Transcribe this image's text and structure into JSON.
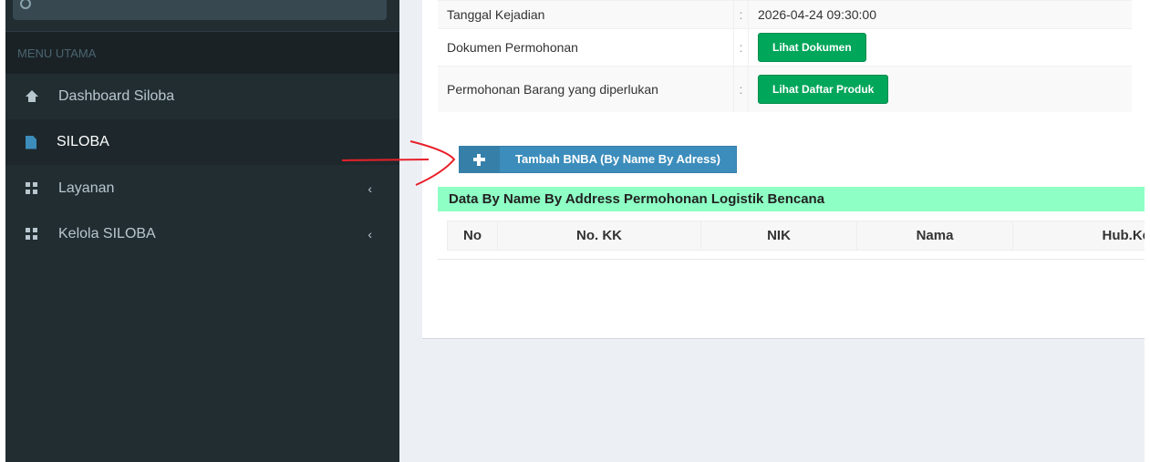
{
  "sidebar": {
    "menu_header": "MENU UTAMA",
    "items": [
      {
        "label": "Dashboard Siloba",
        "icon": "home-icon"
      },
      {
        "label": "SILOBA",
        "icon": "file-icon"
      },
      {
        "label": "Layanan",
        "icon": "grid-icon"
      },
      {
        "label": "Kelola SILOBA",
        "icon": "grid-icon"
      }
    ],
    "chevron": "‹"
  },
  "info": {
    "rows": [
      {
        "label": "Tanggal Kejadian",
        "sep": ":",
        "value": "2026-04-24 09:30:00"
      },
      {
        "label": "Dokumen Permohonan",
        "sep": ":",
        "button": "Lihat Dokumen"
      },
      {
        "label": "Permohonan Barang yang diperlukan",
        "sep": ":",
        "button": "Lihat Daftar Produk"
      }
    ]
  },
  "add_button": {
    "label": "Tambah BNBA (By Name By Adress)"
  },
  "section": {
    "title": "Data By Name By Address Permohonan Logistik Bencana"
  },
  "table": {
    "columns": [
      "No",
      "No. KK",
      "NIK",
      "Nama",
      "Hub.Ke"
    ]
  },
  "colors": {
    "sidebar": "#222d32",
    "success": "#00a65a",
    "primary": "#3c8dbc",
    "section": "#8effc5",
    "annotation": "#e8202a"
  }
}
